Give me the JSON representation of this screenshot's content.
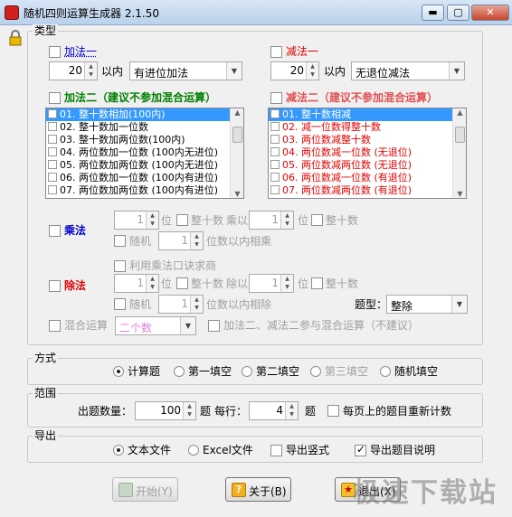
{
  "window": {
    "title": "随机四则运算生成器 2.1.50",
    "min": "▬",
    "max": "▢",
    "close": "✕"
  },
  "colors": {
    "blue": "#0000cc",
    "red": "#e00000",
    "green": "#008000"
  },
  "type_group": {
    "title": "类型"
  },
  "add1": {
    "label": "加法一",
    "checked": false,
    "value": "20",
    "within": "以内",
    "combo": "有进位加法"
  },
  "sub1": {
    "label": "减法一",
    "checked": false,
    "value": "20",
    "within": "以内",
    "combo": "无退位减法"
  },
  "add2": {
    "label": "加法二（建议不参加混合运算）",
    "items": [
      "01. 整十数相加(100内)",
      "02. 整十数加一位数",
      "03. 整十数加两位数(100内)",
      "04. 两位数加一位数 (100内无进位)",
      "05. 两位数加两位数 (100内无进位)",
      "06. 两位数加一位数 (100内有进位)",
      "07. 两位数加两位数 (100内有进位)"
    ]
  },
  "sub2": {
    "label": "减法二（建议不参加混合运算）",
    "items": [
      "01. 整十数相减",
      "02. 减一位数得整十数",
      "03. 两位数减整十数",
      "04. 两位数减一位数 (无退位)",
      "05. 两位数减两位数 (无退位)",
      "06. 两位数减一位数 (有退位)",
      "07. 两位数减两位数 (有退位)"
    ]
  },
  "mul": {
    "label": "乘法",
    "digits1": "1",
    "wei": "位",
    "whole1": "整十数",
    "times": "乘以",
    "digits2": "1",
    "wei2": "位",
    "whole2": "整十数",
    "random": "随机",
    "rand_val": "1",
    "suffix": "位数以内相乘"
  },
  "div": {
    "label": "除法",
    "use_mul": "利用乘法口诀求商",
    "digits1": "1",
    "wei": "位",
    "whole1": "整十数",
    "divby": "除以",
    "digits2": "1",
    "wei2": "位",
    "whole2": "整十数",
    "random": "随机",
    "rand_val": "1",
    "suffix": "位数以内相除",
    "qtype_label": "题型：",
    "qtype": "整除"
  },
  "mixed": {
    "label": "混合运算",
    "combo": "二个数",
    "note": "加法二、减法二参与混合运算（不建议）"
  },
  "mode": {
    "title": "方式",
    "options": [
      "计算题",
      "第一填空",
      "第二填空",
      "第三填空",
      "随机填空"
    ],
    "selected": 0
  },
  "range": {
    "title": "范围",
    "count_label": "出题数量：",
    "count": "100",
    "ti": "题",
    "per_row_label": "每行：",
    "per_row": "4",
    "ti2": "题",
    "recount": "每页上的题目重新计数"
  },
  "export": {
    "title": "导出",
    "options": [
      "文本文件",
      "Excel文件"
    ],
    "selected": 0,
    "vertical": "导出竖式",
    "explain": "导出题目说明",
    "explain_checked": true
  },
  "buttons": {
    "start": "开始(Y)",
    "about": "关于(B)",
    "exit": "退出(X)"
  },
  "watermark": "极速下载站"
}
